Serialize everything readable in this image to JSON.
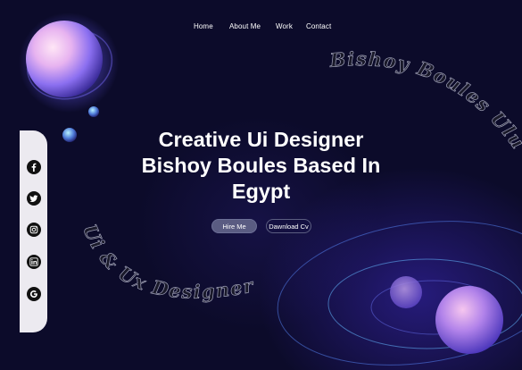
{
  "nav": {
    "items": [
      {
        "label": "Home"
      },
      {
        "label": "About Me"
      },
      {
        "label": "Work"
      },
      {
        "label": "Contact"
      }
    ]
  },
  "hero": {
    "title_line1": "Creative Ui Designer",
    "title_line2": "Bishoy Boules Based In",
    "title_line3": "Egypt",
    "hire_label": "Hire Me",
    "cv_label": "Dawnload Cv"
  },
  "curved_text": {
    "top": "Bishoy Boules Ulus",
    "bottom": "Ui & Ux Designer"
  },
  "social": {
    "icons": [
      "facebook-icon",
      "twitter-icon",
      "instagram-icon",
      "linkedin-icon",
      "google-icon"
    ]
  },
  "colors": {
    "background": "#0c0b2a",
    "accent": "#6b4cff",
    "button_fill": "#5a5c82",
    "social_bar": "#eceaf0"
  }
}
